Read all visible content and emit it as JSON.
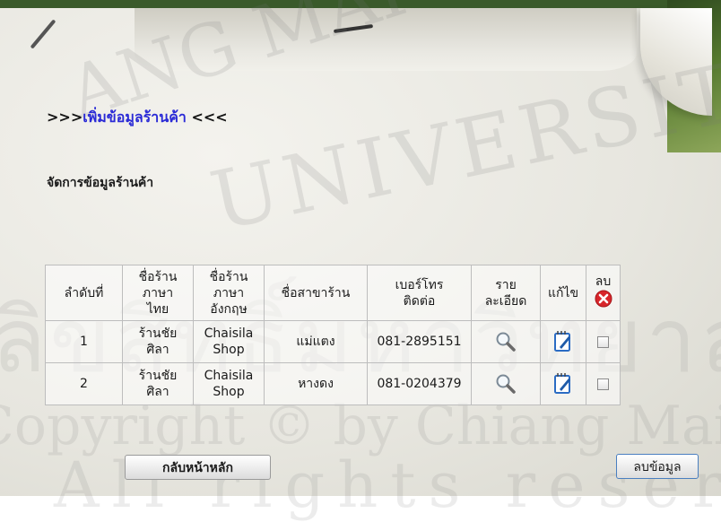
{
  "header": {
    "title_prefix": ">>>",
    "title_main": "เพิ่มข้อมูลร้านค้า",
    "title_suffix": " <<<",
    "subtitle": "จัดการข้อมูลร้านค้า"
  },
  "watermark": {
    "line1": "ANG MAI",
    "line2": "UNIVERSITY",
    "line3": "ลิขสิทธิ์มหาวิทยาลัยเชียงใหม่",
    "line4": "Copyright © by Chiang Mai University",
    "line5": "All rights reserved"
  },
  "table": {
    "headers": {
      "no": "ลำดับที่",
      "name_th_1": "ชื่อร้าน",
      "name_th_2": "ภาษา",
      "name_th_3": "ไทย",
      "name_en_1": "ชื่อร้าน",
      "name_en_2": "ภาษา",
      "name_en_3": "อังกฤษ",
      "branch": "ชื่อสาขาร้าน",
      "phone_1": "เบอร์โทร",
      "phone_2": "ติดต่อ",
      "detail_1": "ราย",
      "detail_2": "ละเอียด",
      "edit": "แก้ไข",
      "delete": "ลบ"
    },
    "rows": [
      {
        "no": "1",
        "name_th_1": "ร้านชัย",
        "name_th_2": "ศิลา",
        "name_en_1": "Chaisila",
        "name_en_2": "Shop",
        "branch": "แม่แตง",
        "phone": "081-2895151"
      },
      {
        "no": "2",
        "name_th_1": "ร้านชัย",
        "name_th_2": "ศิลา",
        "name_en_1": "Chaisila",
        "name_en_2": "Shop",
        "branch": "หางดง",
        "phone": "081-0204379"
      }
    ]
  },
  "buttons": {
    "home": "กลับหน้าหลัก",
    "delete": "ลบข้อมูล"
  },
  "icons": {
    "detail": "magnifier-icon",
    "edit": "edit-note-icon",
    "delete_header": "red-x-icon"
  },
  "colors": {
    "title_accent": "#2a2ad6",
    "delete_icon": "#d8262b",
    "edit_icon": "#2b6cc4"
  }
}
